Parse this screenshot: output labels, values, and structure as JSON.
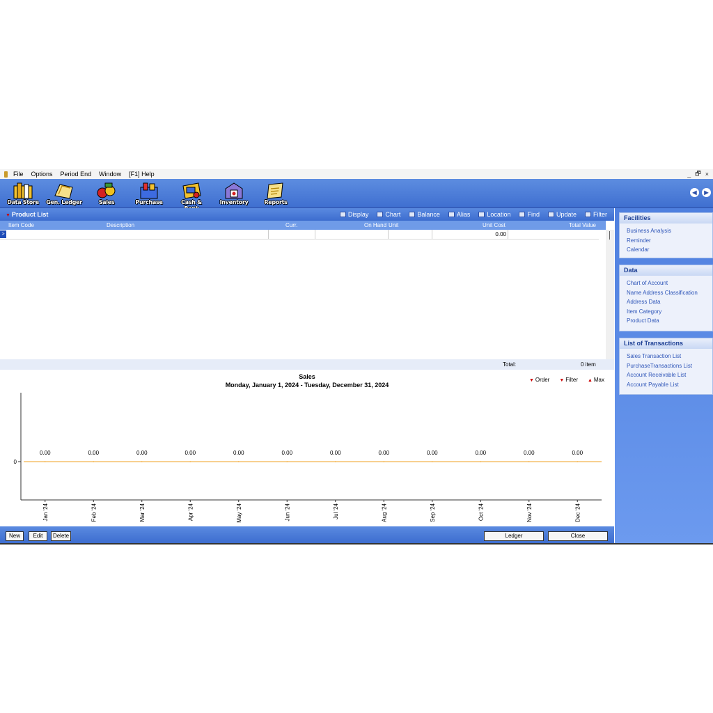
{
  "menubar": {
    "items": [
      "File",
      "Options",
      "Period End",
      "Window",
      "[F1] Help"
    ],
    "window_controls": [
      "_",
      "🗗",
      "×"
    ]
  },
  "toolbar": {
    "items": [
      {
        "label": "Data Store",
        "icon": "datastore-icon"
      },
      {
        "label": "Gen. Ledger",
        "icon": "ledger-icon"
      },
      {
        "label": "Sales",
        "icon": "sales-icon"
      },
      {
        "label": "Purchase",
        "icon": "purchase-icon"
      },
      {
        "label": "Cash & Bank",
        "icon": "cashbank-icon"
      },
      {
        "label": "Inventory",
        "icon": "inventory-icon"
      },
      {
        "label": "Reports",
        "icon": "reports-icon"
      }
    ],
    "nav_prev": "◀",
    "nav_next": "▶"
  },
  "product_list": {
    "title": "Product List",
    "actions": [
      "Display",
      "Chart",
      "Balance",
      "Alias",
      "Location",
      "Find",
      "Update",
      "Filter"
    ],
    "columns": [
      "Item Code",
      "Description",
      "Curr.",
      "On Hand",
      "Unit",
      "Unit Cost",
      "Total Value"
    ],
    "row_marker": ">",
    "row_unit_cost": "0.00",
    "total_label": "Total:",
    "total_value": "0 item"
  },
  "chart_controls": {
    "order": "Order",
    "filter": "Filter",
    "max": "Max"
  },
  "chart_data": {
    "type": "line",
    "title": "Sales",
    "subtitle": "Monday, January 1, 2024 - Tuesday, December 31, 2024",
    "categories": [
      "Jan '24",
      "Feb '24",
      "Mar '24",
      "Apr '24",
      "May '24",
      "Jun '24",
      "Jul '24",
      "Aug '24",
      "Sep '24",
      "Oct '24",
      "Nov '24",
      "Dec '24"
    ],
    "values": [
      0,
      0,
      0,
      0,
      0,
      0,
      0,
      0,
      0,
      0,
      0,
      0
    ],
    "data_labels": [
      "0.00",
      "0.00",
      "0.00",
      "0.00",
      "0.00",
      "0.00",
      "0.00",
      "0.00",
      "0.00",
      "0.00",
      "0.00",
      "0.00"
    ],
    "yticks": [
      "0"
    ],
    "line_color": "#f0a020"
  },
  "buttons": {
    "new": "New",
    "edit": "Edit",
    "delete": "Delete",
    "ledger": "Ledger",
    "close": "Close"
  },
  "sidebar": {
    "facilities": {
      "title": "Facilities",
      "items": [
        "Business Analysis",
        "Reminder",
        "Calendar"
      ]
    },
    "data": {
      "title": "Data",
      "items": [
        "Chart of Account",
        "Name Address Classification",
        "Address Data",
        "Item Category",
        "Product Data"
      ]
    },
    "transactions": {
      "title": "List of Transactions",
      "items": [
        "Sales Transaction List",
        "PurchaseTransactions List",
        "Account Receivable List",
        "Account Payable List"
      ]
    }
  }
}
